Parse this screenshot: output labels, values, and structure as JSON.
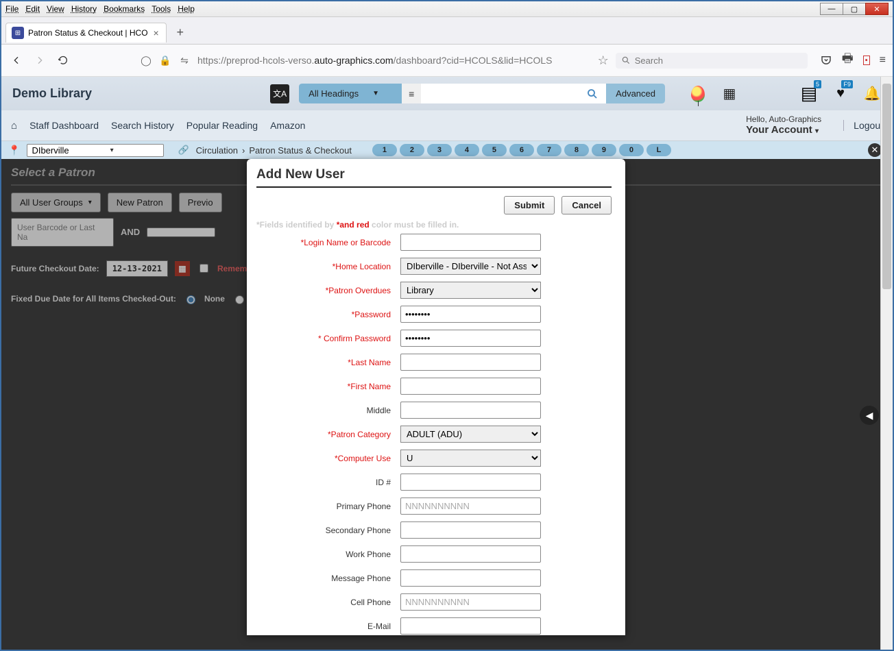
{
  "menubar": [
    "File",
    "Edit",
    "View",
    "History",
    "Bookmarks",
    "Tools",
    "Help"
  ],
  "tab": {
    "title": "Patron Status & Checkout | HCO"
  },
  "url": {
    "prefix": "https://preprod-hcols-verso.",
    "host": "auto-graphics.com",
    "path": "/dashboard?cid=HCOLS&lid=HCOLS"
  },
  "searchbar_placeholder": "Search",
  "library": {
    "brand": "Demo Library",
    "heading_select": "All Headings",
    "advanced": "Advanced",
    "badge_list": "5",
    "badge_heart": "F9",
    "hello": "Hello, Auto-Graphics",
    "account": "Your Account",
    "logout": "Logout"
  },
  "nav": [
    "Staff Dashboard",
    "Search History",
    "Popular Reading",
    "Amazon"
  ],
  "loc": {
    "selected": "DIberville",
    "crumb1": "Circulation",
    "crumb2": "Patron Status & Checkout",
    "quick": [
      "1",
      "2",
      "3",
      "4",
      "5",
      "6",
      "7",
      "8",
      "9",
      "0",
      "L"
    ]
  },
  "patron": {
    "title": "Select a Patron",
    "all_groups": "All User Groups",
    "new_patron": "New Patron",
    "previous": "Previo",
    "barcode_ph": "User Barcode or Last Na",
    "and": "AND",
    "future_label": "Future Checkout Date:",
    "future_date": "12-13-2021",
    "remember": "Rememb",
    "fixed_due": "Fixed Due Date for All Items Checked-Out:",
    "none": "None"
  },
  "modal": {
    "title": "Add New User",
    "submit": "Submit",
    "cancel": "Cancel",
    "note_pre": "*Fields identified by ",
    "note_red": "*and red",
    "note_post": " color must be filled in.",
    "fields": {
      "login": "*Login Name or Barcode",
      "home": "*Home Location",
      "home_val": "DIberville - DIberville - Not Assig",
      "overdues": "*Patron Overdues",
      "overdues_val": "Library",
      "password": "*Password",
      "confirm": "* Confirm Password",
      "last": "*Last Name",
      "first": "*First Name",
      "middle": "Middle",
      "category": "*Patron Category",
      "category_val": "ADULT (ADU)",
      "computer": "*Computer Use",
      "computer_val": "U",
      "idno": "ID #",
      "pphone": "Primary Phone",
      "phone_ph": "NNNNNNNNNN",
      "sphone": "Secondary Phone",
      "wphone": "Work Phone",
      "mphone": "Message Phone",
      "cphone": "Cell Phone",
      "email": "E-Mail"
    }
  }
}
